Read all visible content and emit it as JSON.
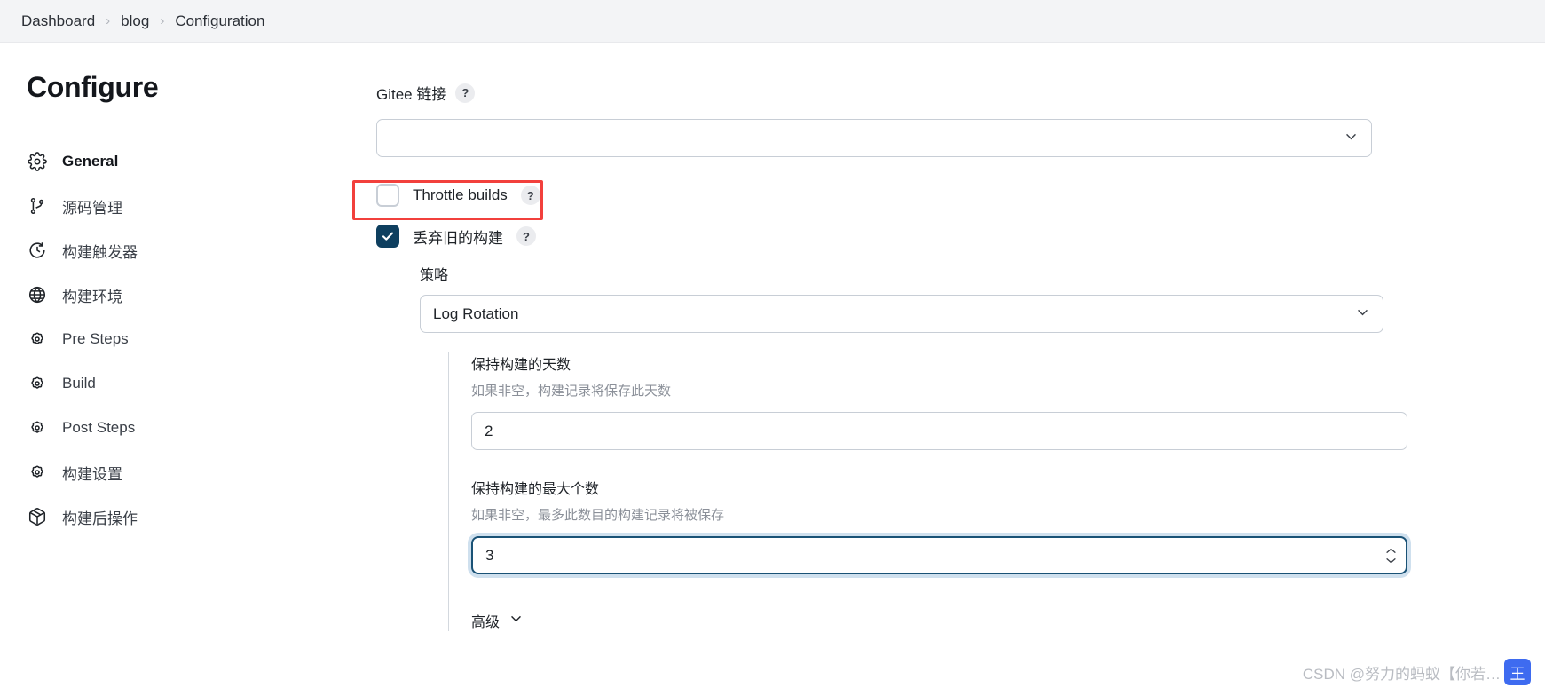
{
  "breadcrumb": {
    "items": [
      {
        "label": "Dashboard"
      },
      {
        "label": "blog"
      },
      {
        "label": "Configuration"
      }
    ],
    "separator": "›"
  },
  "sidebar": {
    "title": "Configure",
    "items": [
      {
        "label": "General",
        "icon": "gear-icon",
        "active": true
      },
      {
        "label": "源码管理",
        "icon": "branch-icon",
        "active": false
      },
      {
        "label": "构建触发器",
        "icon": "clock-icon",
        "active": false
      },
      {
        "label": "构建环境",
        "icon": "globe-icon",
        "active": false
      },
      {
        "label": "Pre Steps",
        "icon": "gear-outline-icon",
        "active": false
      },
      {
        "label": "Build",
        "icon": "gear-outline-icon",
        "active": false
      },
      {
        "label": "Post Steps",
        "icon": "gear-outline-icon",
        "active": false
      },
      {
        "label": "构建设置",
        "icon": "gear-outline-icon",
        "active": false
      },
      {
        "label": "构建后操作",
        "icon": "package-icon",
        "active": false
      }
    ]
  },
  "main": {
    "gitee": {
      "label": "Gitee 链接",
      "help": "?",
      "value": "",
      "placeholder": ""
    },
    "throttle": {
      "label": "Throttle builds",
      "help": "?",
      "checked": false
    },
    "discard": {
      "label": "丢弃旧的构建",
      "help": "?",
      "checked": true,
      "highlight_color": "#f2403c"
    },
    "strategy": {
      "label": "策略",
      "value": "Log Rotation"
    },
    "days_to_keep": {
      "label": "保持构建的天数",
      "hint": "如果非空，构建记录将保存此天数",
      "value": "2",
      "focused": false
    },
    "num_to_keep": {
      "label": "保持构建的最大个数",
      "hint": "如果非空，最多此数目的构建记录将被保存",
      "value": "3",
      "focused": true
    },
    "advanced": {
      "label": "高级"
    }
  },
  "watermark": {
    "text": "CSDN @努力的蚂蚁【你若…",
    "logo_char": "王",
    "logo_color": "#3e6bf0"
  }
}
